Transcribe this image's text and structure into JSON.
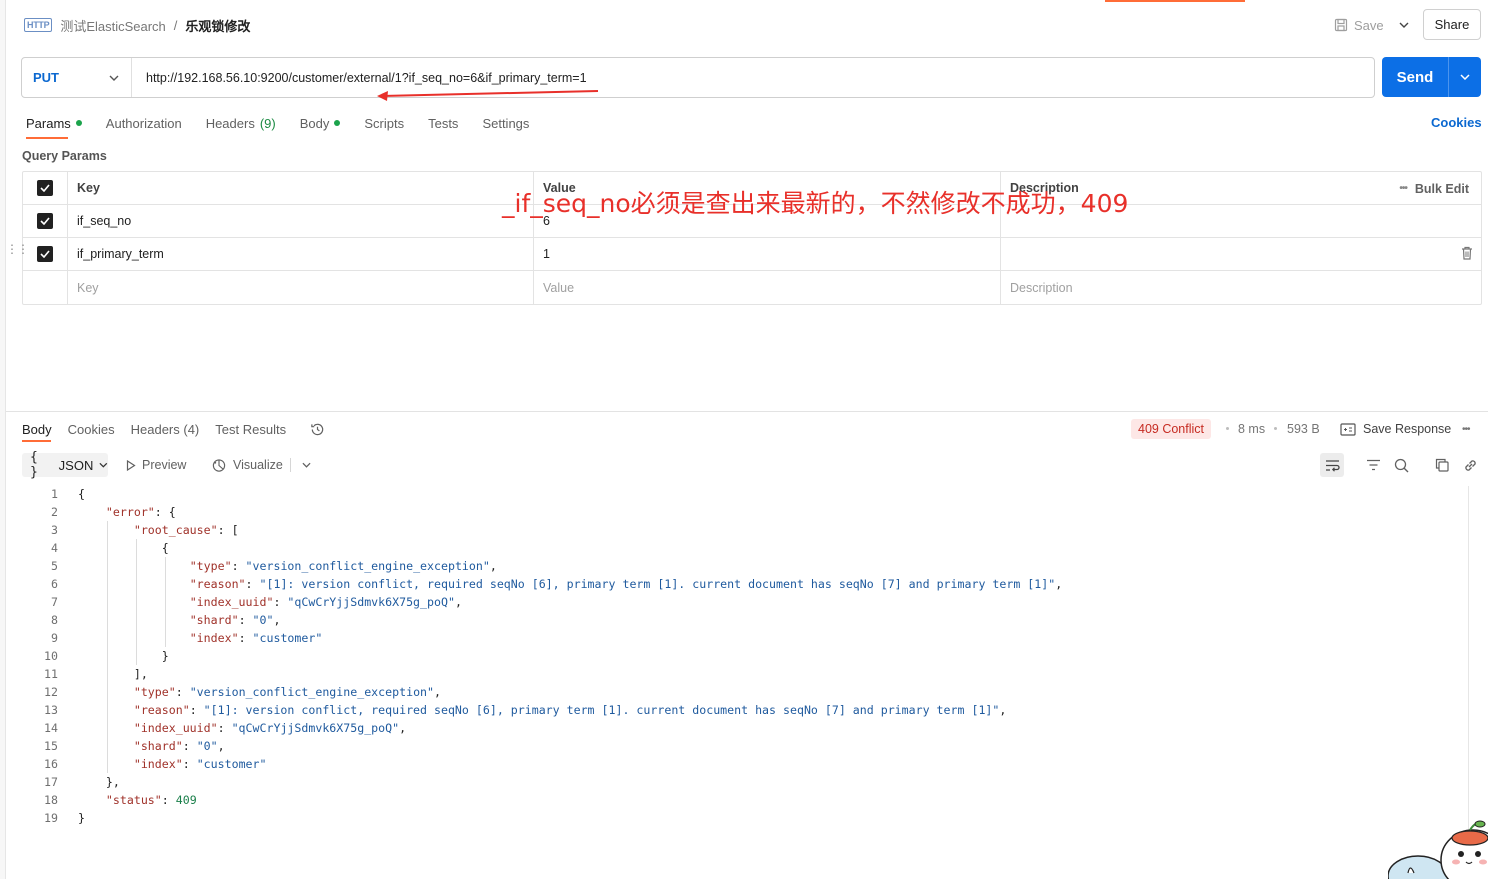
{
  "header": {
    "request_type_icon": "HTTP",
    "breadcrumb_parent": "测试ElasticSearch",
    "breadcrumb_separator": "/",
    "request_name": "乐观锁修改",
    "save_label": "Save",
    "share_label": "Share"
  },
  "request": {
    "method": "PUT",
    "url": "http://192.168.56.10:9200/customer/external/1?if_seq_no=6&if_primary_term=1",
    "send_label": "Send"
  },
  "request_tabs": [
    {
      "label": "Params",
      "count": "",
      "dot": true,
      "active": true
    },
    {
      "label": "Authorization",
      "count": "",
      "dot": false
    },
    {
      "label": "Headers",
      "count": "(9)",
      "dot": false
    },
    {
      "label": "Body",
      "count": "",
      "dot": true
    },
    {
      "label": "Scripts",
      "count": "",
      "dot": false
    },
    {
      "label": "Tests",
      "count": "",
      "dot": false
    },
    {
      "label": "Settings",
      "count": "",
      "dot": false
    }
  ],
  "cookies_label": "Cookies",
  "query_params": {
    "title": "Query Params",
    "columns": {
      "key": "Key",
      "value": "Value",
      "description": "Description"
    },
    "bulk_edit": "Bulk Edit",
    "rows": [
      {
        "key": "if_seq_no",
        "value": "6",
        "description": ""
      },
      {
        "key": "if_primary_term",
        "value": "1",
        "description": ""
      }
    ],
    "placeholders": {
      "key": "Key",
      "value": "Value",
      "description": "Description"
    }
  },
  "annotation": "_if_seq_no必须是查出来最新的，不然修改不成功，409",
  "response": {
    "tabs": [
      {
        "label": "Body",
        "count": ""
      },
      {
        "label": "Cookies",
        "count": ""
      },
      {
        "label": "Headers",
        "count": "(4)"
      },
      {
        "label": "Test Results",
        "count": ""
      }
    ],
    "status": "409 Conflict",
    "time": "8 ms",
    "size": "593 B",
    "save_response": "Save Response",
    "format_label": "JSON",
    "preview_label": "Preview",
    "visualize_label": "Visualize",
    "lines": [
      "{",
      "    \"error\": {",
      "        \"root_cause\": [",
      "            {",
      "                \"type\": \"version_conflict_engine_exception\",",
      "                \"reason\": \"[1]: version conflict, required seqNo [6], primary term [1]. current document has seqNo [7] and primary term [1]\",",
      "                \"index_uuid\": \"qCwCrYjjSdmvk6X75g_poQ\",",
      "                \"shard\": \"0\",",
      "                \"index\": \"customer\"",
      "            }",
      "        ],",
      "        \"type\": \"version_conflict_engine_exception\",",
      "        \"reason\": \"[1]: version conflict, required seqNo [6], primary term [1]. current document has seqNo [7] and primary term [1]\",",
      "        \"index_uuid\": \"qCwCrYjjSdmvk6X75g_poQ\",",
      "        \"shard\": \"0\",",
      "        \"index\": \"customer\"",
      "    },",
      "    \"status\": 409",
      "}"
    ]
  },
  "colors": {
    "accent": "#ff6c37",
    "send": "#0c6fe6",
    "method": "#0b68d0",
    "annotation": "#e8302a",
    "status_bg": "#fde7e6",
    "status_fg": "#c62b22"
  }
}
